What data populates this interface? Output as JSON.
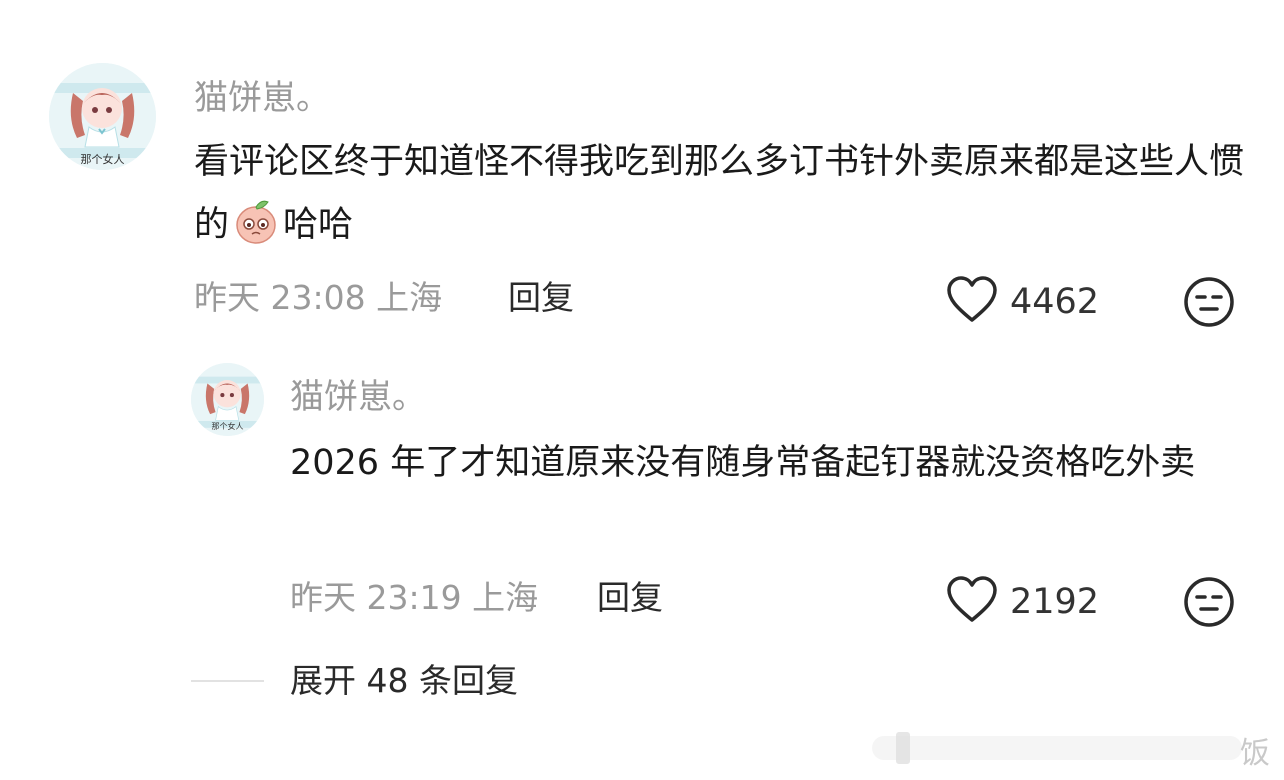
{
  "comment": {
    "username": "猫饼崽。",
    "avatar_caption": "那个女人",
    "text_before_emoji": "看评论区终于知道怪不得我吃到那么多订书针外卖原来都是这些人惯的",
    "emoji": "peach-crying-emoji",
    "text_after_emoji": "哈哈",
    "time": "昨天 23:08 上海",
    "reply_label": "回复",
    "likes": "4462"
  },
  "reply": {
    "username": "猫饼崽。",
    "avatar_caption": "那个女人",
    "text": "2026 年了才知道原来没有随身常备起钉器就没资格吃外卖",
    "time": "昨天 23:19 上海",
    "reply_label": "回复",
    "likes": "2192"
  },
  "expand_label": "展开 48 条回复",
  "watermark": "饭",
  "icons": {
    "like": "heart-outline-icon",
    "dislike": "neutral-face-icon"
  },
  "colors": {
    "text": "#1a1a1a",
    "muted": "#9a9a9a",
    "background": "#ffffff"
  }
}
